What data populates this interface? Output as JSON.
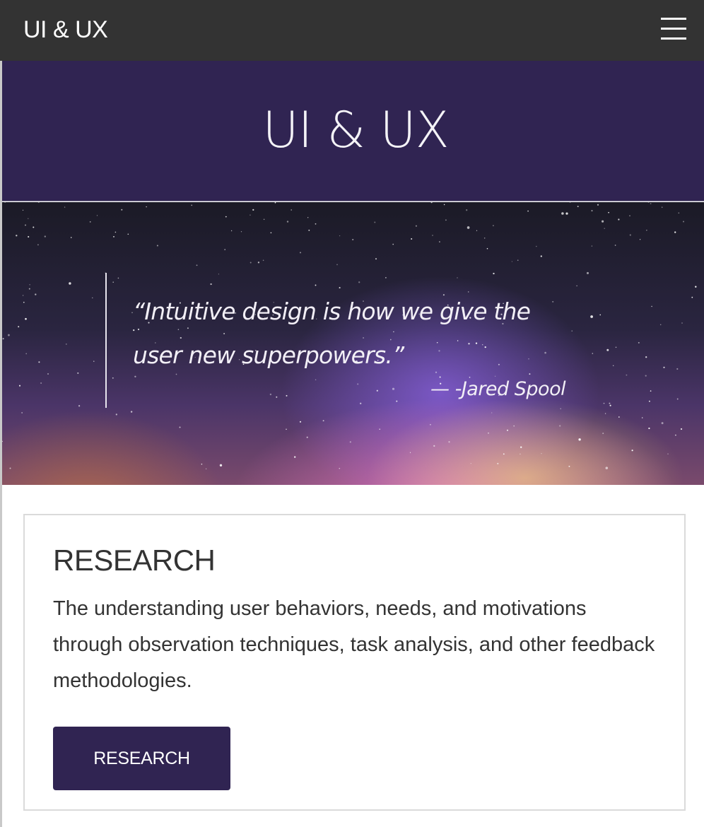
{
  "navbar": {
    "brand": "UI & UX",
    "menu_icon": "hamburger-menu-icon"
  },
  "header": {
    "title": "UI & UX",
    "background_color": "#302452"
  },
  "hero": {
    "quote": "“Intuitive design is how we give the user new superpowers.”",
    "attribution": "— -Jared Spool"
  },
  "research_card": {
    "title": "RESEARCH",
    "body": "The understanding user behaviors, needs, and motivations through observation techniques, task analysis, and other feedback methodologies.",
    "button_label": "RESEARCH",
    "button_color": "#302452"
  }
}
